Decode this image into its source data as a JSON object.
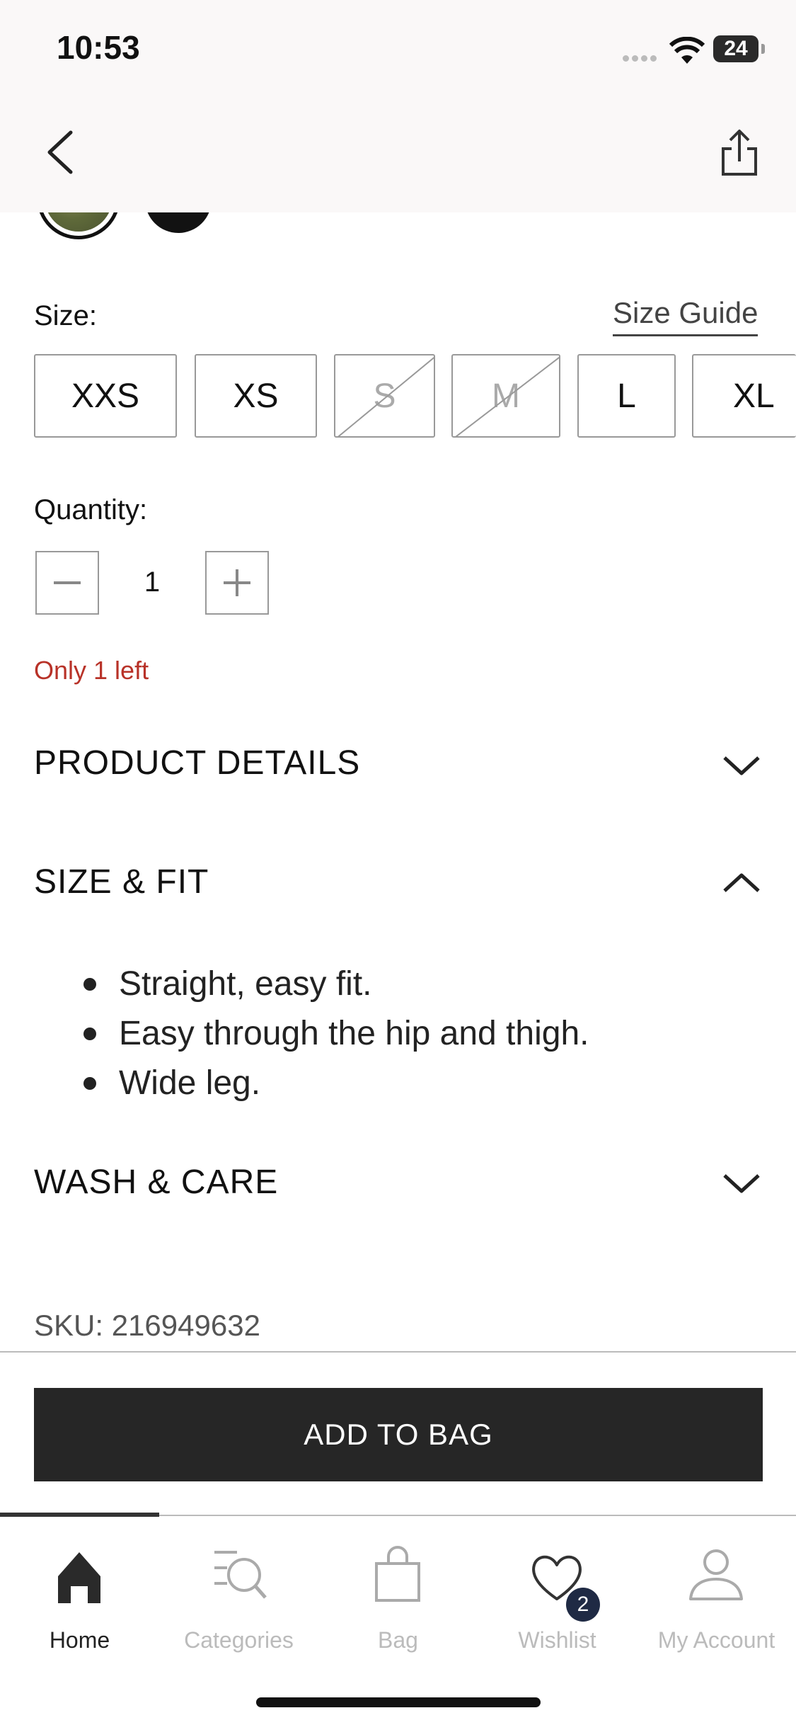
{
  "status_bar": {
    "time": "10:53",
    "battery": "24"
  },
  "size": {
    "label": "Size:",
    "guide_link": "Size Guide",
    "options": [
      {
        "label": "XXS",
        "available": true
      },
      {
        "label": "XS",
        "available": true
      },
      {
        "label": "S",
        "available": false
      },
      {
        "label": "M",
        "available": false
      },
      {
        "label": "L",
        "available": true
      },
      {
        "label": "XL",
        "available": true
      }
    ]
  },
  "quantity": {
    "label": "Quantity:",
    "value": "1"
  },
  "stock_notice": "Only 1 left",
  "sections": {
    "product_details": "PRODUCT DETAILS",
    "size_fit": "SIZE & FIT",
    "size_fit_bullets": [
      "Straight, easy fit.",
      "Easy through the hip and thigh.",
      "Wide leg."
    ],
    "wash_care": "WASH & CARE"
  },
  "sku": "SKU: 216949632",
  "add_to_bag": "ADD TO BAG",
  "tabs": [
    {
      "label": "Home",
      "icon": "home-icon",
      "active": true
    },
    {
      "label": "Categories",
      "icon": "categories-search-icon",
      "active": false
    },
    {
      "label": "Bag",
      "icon": "bag-icon",
      "active": false
    },
    {
      "label": "Wishlist",
      "icon": "heart-icon",
      "active": false,
      "badge": "2"
    },
    {
      "label": "My Account",
      "icon": "user-icon",
      "active": false
    }
  ],
  "colors": {
    "stock_red": "#b83228",
    "button_dark": "#262626",
    "badge_navy": "#1f2a44"
  }
}
